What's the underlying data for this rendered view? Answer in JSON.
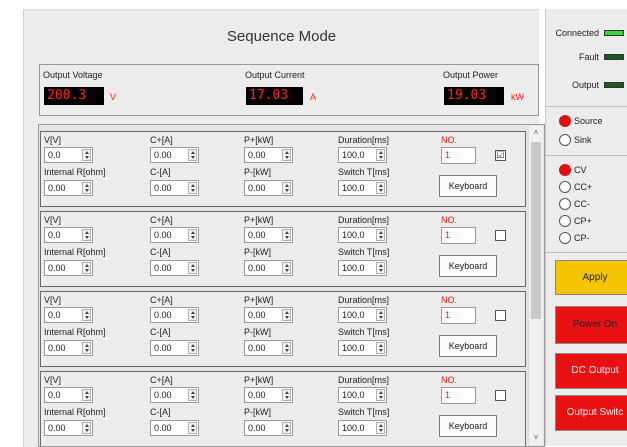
{
  "title": "Sequence Mode",
  "outputs": {
    "voltage": {
      "label": "Output Voltage",
      "value": "200.3",
      "unit": "V"
    },
    "current": {
      "label": "Output Current",
      "value": "17.03",
      "unit": "A"
    },
    "power": {
      "label": "Output Power",
      "value": "19.03",
      "unit": "kW"
    }
  },
  "labels": {
    "v": "V[V]",
    "cplus": "C+[A]",
    "pplus": "P+[kW]",
    "duration": "Duration[ms]",
    "no": "NO.",
    "rint": "Internal R[ohm]",
    "cminus": "C-[A]",
    "pminus": "P-[kW]",
    "switch": "Switch T[ms]"
  },
  "rows": [
    {
      "v": "0.0",
      "cplus": "0.00",
      "pplus": "0.00",
      "duration": "100.0",
      "no": "1",
      "checked": true,
      "rint": "0.00",
      "cminus": "0.00",
      "pminus": "0.00",
      "switch": "100.0",
      "keyboard": "Keyboard",
      "check_mark": "☑"
    },
    {
      "v": "0.0",
      "cplus": "0.00",
      "pplus": "0.00",
      "duration": "100.0",
      "no": "1",
      "checked": false,
      "rint": "0.00",
      "cminus": "0.00",
      "pminus": "0.00",
      "switch": "100.0",
      "keyboard": "Keyboard",
      "check_mark": ""
    },
    {
      "v": "0.0",
      "cplus": "0.00",
      "pplus": "0.00",
      "duration": "100.0",
      "no": "1",
      "checked": false,
      "rint": "0.00",
      "cminus": "0.00",
      "pminus": "0.00",
      "switch": "100.0",
      "keyboard": "Keyboard",
      "check_mark": ""
    },
    {
      "v": "0.0",
      "cplus": "0.00",
      "pplus": "0.00",
      "duration": "100.0",
      "no": "1",
      "checked": false,
      "rint": "0.00",
      "cminus": "0.00",
      "pminus": "0.00",
      "switch": "100.0",
      "keyboard": "Keyboard",
      "check_mark": ""
    }
  ],
  "scroll": {
    "up": "˄",
    "down": "˅"
  },
  "status": {
    "connected": {
      "label": "Connected",
      "color": "#3ad83a"
    },
    "fault": {
      "label": "Fault",
      "color": "#1e5a1e"
    },
    "output": {
      "label": "Output",
      "color": "#1e5a1e"
    }
  },
  "direction": {
    "source": "Source",
    "sink": "Sink",
    "selected": "Source"
  },
  "modes": {
    "items": [
      "CV",
      "CC+",
      "CC-",
      "CP+",
      "CP-"
    ],
    "selected": "CV"
  },
  "buttons": {
    "apply": {
      "label": "Apply",
      "color": "#f5c400"
    },
    "power_on": {
      "label": "Power On",
      "color": "#e81010"
    },
    "dc_output": {
      "label": "DC Output",
      "color": "#e81010"
    },
    "output_switch": {
      "label": "Output Switc",
      "color": "#e81010"
    }
  }
}
